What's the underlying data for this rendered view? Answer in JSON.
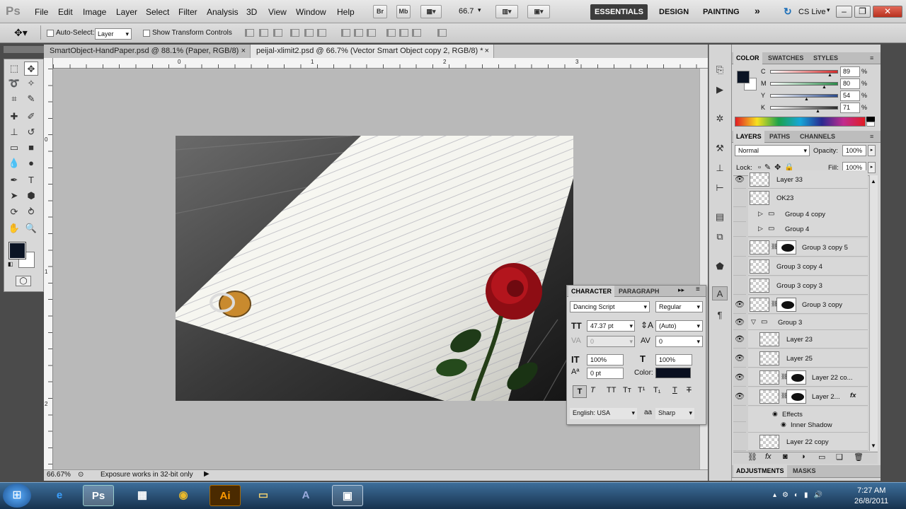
{
  "app": {
    "logo": "Ps"
  },
  "menu": [
    "File",
    "Edit",
    "Image",
    "Layer",
    "Select",
    "Filter",
    "Analysis",
    "3D",
    "View",
    "Window",
    "Help"
  ],
  "menubar": {
    "bridge": "Br",
    "minibridge": "Mb",
    "zoom": "66.7"
  },
  "workspaces": {
    "essentials": "ESSENTIALS",
    "design": "DESIGN",
    "painting": "PAINTING",
    "more": "»",
    "cslive": "CS Live"
  },
  "options": {
    "auto_select_label": "Auto-Select:",
    "auto_select_value": "Layer",
    "transform_label": "Show Transform Controls"
  },
  "tabs": [
    {
      "label": "SmartObject-HandPaper.psd @ 88.1% (Paper, RGB/8)",
      "close": "×"
    },
    {
      "label": "peijal-xlimit2.psd @ 66.7% (Vector Smart Object copy 2, RGB/8) *",
      "close": "×"
    }
  ],
  "rulers": {
    "top": [
      "0",
      "1",
      "2",
      "3"
    ],
    "left": [
      "0",
      "1",
      "2"
    ]
  },
  "status": {
    "zoom": "66.67%",
    "message": "Exposure works in 32-bit only"
  },
  "color_panel": {
    "tabs": [
      "COLOR",
      "SWATCHES",
      "STYLES"
    ],
    "channels": [
      {
        "label": "C",
        "value": "89",
        "unit": "%",
        "fraction": 0.89,
        "color": "#d42a2a"
      },
      {
        "label": "M",
        "value": "80",
        "unit": "%",
        "fraction": 0.8,
        "color": "#2a8c4a"
      },
      {
        "label": "Y",
        "value": "54",
        "unit": "%",
        "fraction": 0.54,
        "color": "#2a4a8c"
      },
      {
        "label": "K",
        "value": "71",
        "unit": "%",
        "fraction": 0.71,
        "color": "#2a2a2a"
      }
    ],
    "foreground": "#0b1424",
    "background": "#ffffff"
  },
  "layers_panel": {
    "tabs": [
      "LAYERS",
      "PATHS",
      "CHANNELS"
    ],
    "blend_mode": "Normal",
    "opacity_label": "Opacity:",
    "opacity": "100%",
    "lock_label": "Lock:",
    "fill_label": "Fill:",
    "fill": "100%",
    "layers": [
      {
        "name": "Layer 33",
        "visible": true
      },
      {
        "name": "OK23",
        "visible": false
      },
      {
        "name": "Group 4 copy",
        "visible": false
      },
      {
        "name": "Group 4",
        "visible": false
      },
      {
        "name": "Group 3 copy 5",
        "visible": false
      },
      {
        "name": "Group 3 copy 4",
        "visible": false
      },
      {
        "name": "Group 3 copy 3",
        "visible": false
      },
      {
        "name": "Group 3 copy",
        "visible": true
      },
      {
        "name": "Group 3",
        "visible": true
      },
      {
        "name": "Layer 23",
        "visible": true
      },
      {
        "name": "Layer 25",
        "visible": true
      },
      {
        "name": "Layer 22 co...",
        "visible": true
      },
      {
        "name": "Layer 2...",
        "visible": true
      },
      {
        "name": "Effects",
        "visible": true
      },
      {
        "name": "Inner Shadow",
        "visible": true
      },
      {
        "name": "Layer 22 copy",
        "visible": false
      }
    ],
    "fx": "fx"
  },
  "bottom_tabs": [
    "ADJUSTMENTS",
    "MASKS"
  ],
  "character_panel": {
    "tabs": [
      "CHARACTER",
      "PARAGRAPH"
    ],
    "font": "Dancing Script",
    "style": "Regular",
    "size": "47.37 pt",
    "leading": "(Auto)",
    "kerning": "0",
    "tracking": "0",
    "vscale": "100%",
    "hscale": "100%",
    "baseline": "0 pt",
    "color_label": "Color:",
    "color": "#0a1020",
    "language": "English: USA",
    "antialias_icon": "aa",
    "antialias": "Sharp"
  },
  "taskbar": {
    "time": "7:27 AM",
    "date": "26/8/2011",
    "apps": [
      "Ps",
      "Ai"
    ]
  }
}
